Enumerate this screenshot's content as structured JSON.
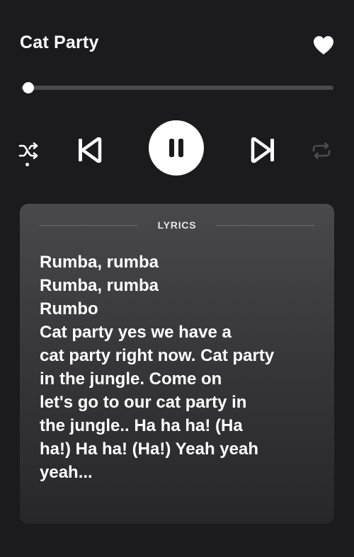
{
  "track": {
    "title": "Cat Party",
    "liked": true,
    "progress_fraction": 0.0
  },
  "controls": {
    "shuffle_icon": "shuffle-icon",
    "shuffle_active": true,
    "prev_icon": "skip-previous-icon",
    "play_state": "playing",
    "play_icon": "pause-icon",
    "next_icon": "skip-next-icon",
    "repeat_icon": "repeat-icon",
    "repeat_active": false
  },
  "lyrics": {
    "label": "LYRICS",
    "lines": [
      "Rumba, rumba",
      "Rumba, rumba",
      "Rumbo",
      "Cat party yes we have a",
      "cat party right now. Cat party",
      "in the jungle. Come on",
      "let's go to our cat party in",
      "the jungle.. Ha ha ha! (Ha",
      "ha!) Ha ha! (Ha!) Yeah yeah",
      "yeah..."
    ]
  },
  "colors": {
    "background": "#1b1a1d",
    "foreground": "#ffffff",
    "track": "#4a494d",
    "inactive_icon": "#4d4c50"
  }
}
